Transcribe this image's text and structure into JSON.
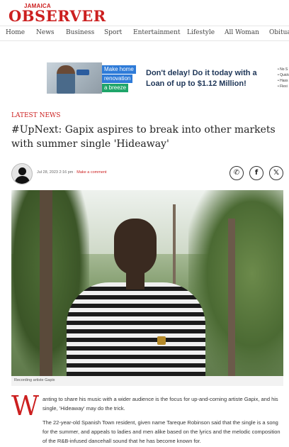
{
  "header": {
    "logo_top": "JAMAICA",
    "logo_main": "OBSERVER"
  },
  "nav": {
    "items": [
      "Home",
      "News",
      "Business",
      "Sport",
      "Entertainment",
      "Lifestyle",
      "All Woman",
      "Obituaries"
    ]
  },
  "ad": {
    "tags": [
      "Make home",
      "renovation",
      "a breeze"
    ],
    "headline": "Don't delay! Do it today with a Loan of up to $1.12 Million!",
    "list": [
      "• No S",
      "• Quick",
      "• Hass",
      "• Flexi"
    ]
  },
  "article": {
    "category": "LATEST NEWS",
    "title": "#UpNext: Gapix aspires to break into other markets with summer single 'Hideaway'",
    "date": "Jul 28, 2023 2:16 pm",
    "separator": "·",
    "comment_link": "Make a comment",
    "caption": "Recording artiste Gapix",
    "dropcap": "W",
    "para1": "anting to share his music with a wider audience is the focus for up-and-coming artiste Gapix, and his single, 'Hideaway' may do the trick.",
    "para2": "The 22-year-old Spanish Town resident, given name Tareque Robinson said that the single is a song for the summer, and appeals to ladies and men alike based on the lyrics and the melodic composition of the R&B-infused dancehall sound that he has become known for."
  },
  "share": {
    "whatsapp": "✆",
    "facebook": "f",
    "twitter": "𝕏"
  },
  "colors": {
    "brand_red": "#cc1f1f",
    "ad_blue": "#2e7bd8",
    "ad_green": "#1fa56a"
  }
}
